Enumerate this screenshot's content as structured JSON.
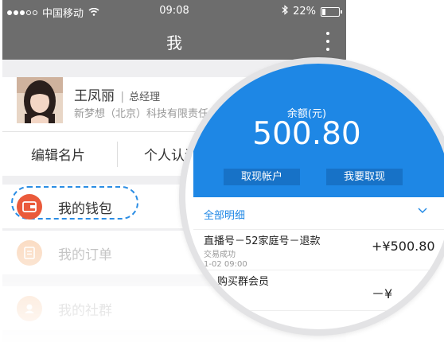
{
  "status_bar": {
    "carrier": "中国移动",
    "time": "09:08",
    "battery_percent": "22%",
    "battery_level": 0.22
  },
  "nav": {
    "title": "我"
  },
  "profile": {
    "name": "王凤丽",
    "separator": "|",
    "title": "总经理",
    "company": "新梦想（北京）科技有限责任"
  },
  "actions": {
    "edit_card": "编辑名片",
    "personal_cert": "个人认证"
  },
  "menu": {
    "wallet": "我的钱包",
    "orders": "我的订单",
    "community": "我的社群"
  },
  "colors": {
    "wallet_icon": "#ea5a3b",
    "orders_icon": "#f8c9a3",
    "community_icon": "#f8c9a3",
    "accent_blue": "#1e87e5",
    "focus_ring": "#2b8de4"
  },
  "wallet_detail": {
    "balance_label": "余额(元)",
    "balance": "500.80",
    "withdraw_account": "取现帐户",
    "withdraw": "我要取现",
    "all_details": "全部明细",
    "transactions": [
      {
        "title": "直播号－52家庭号－退款",
        "status": "交易成功",
        "time": "1-02 09:00",
        "amount": "+¥500.80"
      },
      {
        "title": "购买群会员",
        "amount": "－¥"
      }
    ]
  },
  "icons": [
    "wifi-icon",
    "bluetooth-icon",
    "battery-icon",
    "more-vertical-icon",
    "wallet-icon",
    "orders-icon",
    "community-icon",
    "chevron-down-icon"
  ]
}
